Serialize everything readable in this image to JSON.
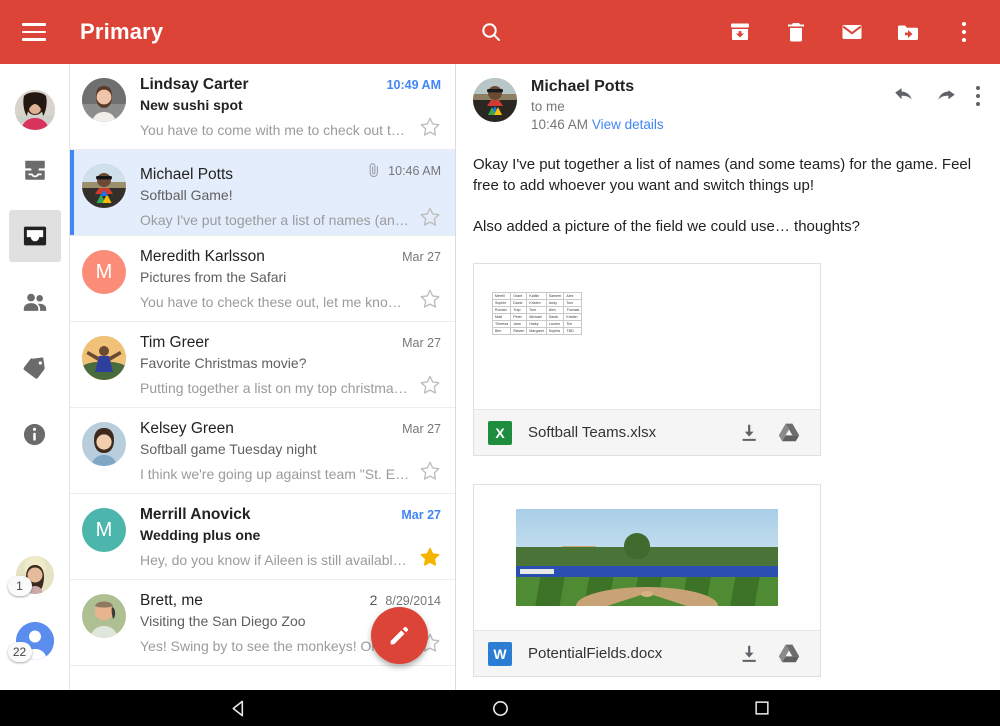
{
  "appbar": {
    "title": "Primary",
    "menu_icon": "hamburger-menu-icon",
    "search_icon": "search-icon",
    "actions": [
      {
        "name": "archive-button",
        "icon": "archive-icon"
      },
      {
        "name": "delete-button",
        "icon": "trash-icon"
      },
      {
        "name": "mark-unread-button",
        "icon": "envelope-icon"
      },
      {
        "name": "move-to-folder-button",
        "icon": "folder-move-icon"
      },
      {
        "name": "overflow-menu-button",
        "icon": "more-vertical-icon"
      }
    ],
    "bg_color": "#DB4437"
  },
  "rail": {
    "avatar": {
      "name": "user-avatar",
      "alt": "account photo"
    },
    "items": [
      {
        "name": "sidebar-item-all-inbox",
        "icon": "all-inbox-icon",
        "selected": false
      },
      {
        "name": "sidebar-item-primary",
        "icon": "inbox-icon",
        "selected": true
      },
      {
        "name": "sidebar-item-social",
        "icon": "people-icon",
        "selected": false
      },
      {
        "name": "sidebar-item-promotions",
        "icon": "tag-icon",
        "selected": false
      },
      {
        "name": "sidebar-item-updates",
        "icon": "info-icon",
        "selected": false
      }
    ],
    "accounts": [
      {
        "name": "account-switcher-1",
        "badge": "1",
        "type": "photo"
      },
      {
        "name": "account-switcher-2",
        "badge": "22",
        "type": "placeholder"
      }
    ]
  },
  "list": {
    "rows": [
      {
        "sender": "Lindsay Carter",
        "subject": "New sushi spot",
        "snippet": "You have to come with me to check out thi…",
        "date": "10:49 AM",
        "unread": true,
        "selected": false,
        "starred": false,
        "attachment": false,
        "count": "",
        "avatar_kind": "photo",
        "avatar_letter": "",
        "avatar_color": "#c9a59c"
      },
      {
        "sender": "Michael Potts",
        "subject": "Softball Game!",
        "snippet": "Okay I've put together a list of names (and…",
        "date": "10:46 AM",
        "unread": false,
        "selected": true,
        "starred": false,
        "attachment": true,
        "count": "",
        "avatar_kind": "photo",
        "avatar_letter": "",
        "avatar_color": "#7d7560"
      },
      {
        "sender": "Meredith Karlsson",
        "subject": "Pictures from the Safari",
        "snippet": "You have to check these out, let me know …",
        "date": "Mar 27",
        "unread": false,
        "selected": false,
        "starred": false,
        "attachment": false,
        "count": "",
        "avatar_kind": "letter",
        "avatar_letter": "M",
        "avatar_color": "#FA8C78"
      },
      {
        "sender": "Tim Greer",
        "subject": "Favorite Christmas movie?",
        "snippet": "Putting together a list on my top christmas…",
        "date": "Mar 27",
        "unread": false,
        "selected": false,
        "starred": false,
        "attachment": false,
        "count": "",
        "avatar_kind": "photo",
        "avatar_letter": "",
        "avatar_color": "#d9b46a"
      },
      {
        "sender": "Kelsey Green",
        "subject": "Softball game Tuesday night",
        "snippet": "I think we're going up against team \"St. El…",
        "date": "Mar 27",
        "unread": false,
        "selected": false,
        "starred": false,
        "attachment": false,
        "count": "",
        "avatar_kind": "photo",
        "avatar_letter": "",
        "avatar_color": "#9fb6c4"
      },
      {
        "sender": "Merrill Anovick",
        "subject": "Wedding plus one",
        "snippet": "Hey, do you know if Aileen is still available…",
        "date": "Mar 27",
        "unread": true,
        "selected": false,
        "starred": true,
        "attachment": false,
        "count": "",
        "avatar_kind": "letter",
        "avatar_letter": "M",
        "avatar_color": "#4DB6AC"
      },
      {
        "sender": "Brett, me",
        "subject": "Visiting the San Diego Zoo",
        "snippet": "Yes! Swing by to see the monkeys! On F…",
        "date": "8/29/2014",
        "unread": false,
        "selected": false,
        "starred": false,
        "attachment": false,
        "count": "2",
        "avatar_kind": "photo",
        "avatar_letter": "",
        "avatar_color": "#b8c6a8"
      }
    ],
    "compose_fab": {
      "name": "compose-button",
      "icon": "pencil-icon",
      "color": "#DB4437"
    },
    "star_on_color": "#F4B400",
    "selected_row_color": "#E4EDFC",
    "accent_color": "#4285F4"
  },
  "reader": {
    "from": "Michael Potts",
    "to": "to me",
    "time": "10:46 AM",
    "details_link": "View details",
    "actions": [
      {
        "name": "reply-button",
        "icon": "reply-arrow-icon"
      },
      {
        "name": "forward-button",
        "icon": "forward-arrow-icon"
      },
      {
        "name": "message-overflow-button",
        "icon": "more-vertical-icon"
      }
    ],
    "body": [
      "Okay I've put together a list of names (and some teams) for the game. Feel free to add whoever you want and switch things up!",
      "Also added a picture of the field we could use… thoughts?"
    ],
    "attachments": [
      {
        "name": "Softball Teams.xlsx",
        "type": "xlsx",
        "type_letter": "X",
        "type_color": "#1E8E3E",
        "preview": "spreadsheet",
        "download_icon": "download-icon",
        "drive_icon": "google-drive-icon",
        "sheet_rows": [
          [
            "Merrill",
            "Grant",
            "Kaitlin",
            "Sameer",
            "Alex"
          ],
          [
            "Sophie",
            "David",
            "Kristen",
            "Andy",
            "Tom"
          ],
          [
            "Roman",
            "Trap",
            "Tom",
            "Alex",
            "Thomas"
          ],
          [
            "Matt",
            "Peter",
            "Michael",
            "Sarah",
            "Kristen"
          ],
          [
            "Theresa",
            "Jane",
            "Haley",
            "Lauren",
            "Tim"
          ],
          [
            "Ben",
            "Steven",
            "Margaret",
            "Sophia",
            "TBD"
          ]
        ]
      },
      {
        "name": "PotentialFields.docx",
        "type": "docx",
        "type_letter": "W",
        "type_color": "#2B7CD3",
        "preview": "image",
        "download_icon": "download-icon",
        "drive_icon": "google-drive-icon",
        "sheet_rows": []
      }
    ]
  },
  "navbar": {
    "buttons": [
      {
        "name": "android-back-button",
        "icon": "back-triangle-icon"
      },
      {
        "name": "android-home-button",
        "icon": "home-circle-icon"
      },
      {
        "name": "android-recents-button",
        "icon": "recents-square-icon"
      }
    ]
  }
}
